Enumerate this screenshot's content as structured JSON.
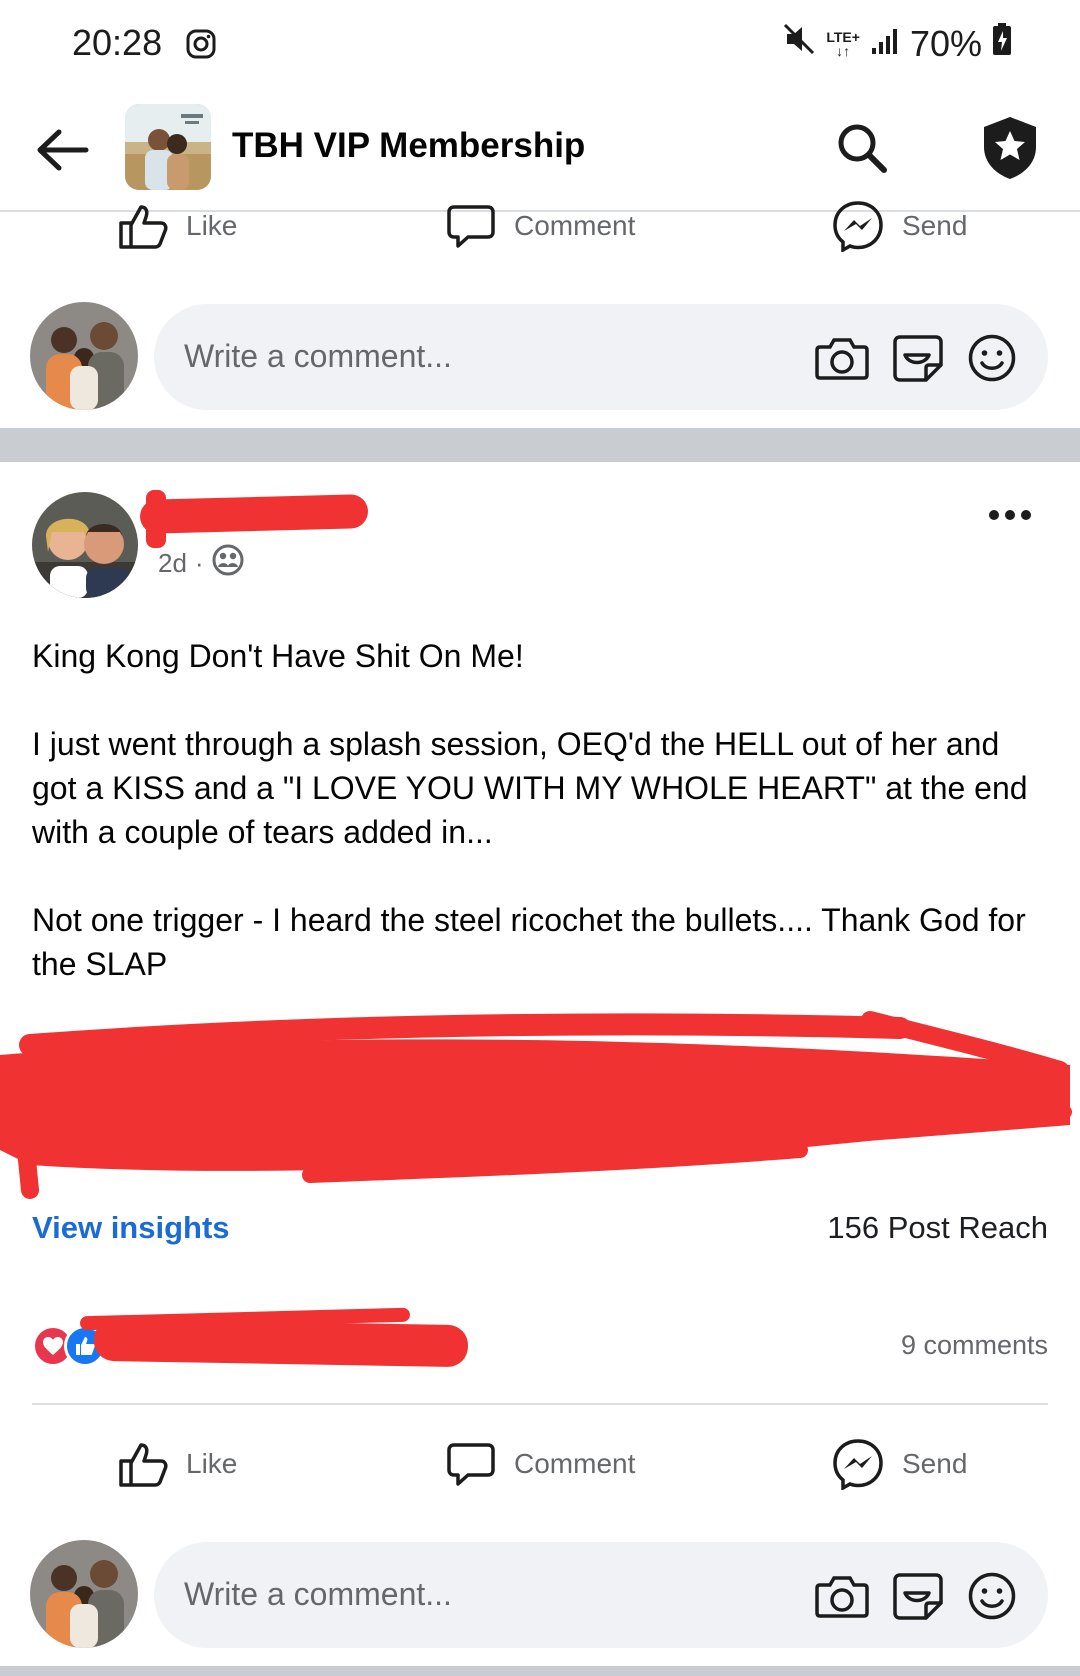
{
  "status_bar": {
    "time": "20:28",
    "network": "LTE+",
    "battery": "70%",
    "icons": [
      "instagram-icon",
      "mute-icon",
      "signal-icon",
      "battery-charging-icon"
    ]
  },
  "header": {
    "group_name": "TBH VIP Membership",
    "icons": [
      "back-arrow-icon",
      "search-icon",
      "shield-star-icon"
    ]
  },
  "prev_post_actions": {
    "like": "Like",
    "comment": "Comment",
    "send": "Send"
  },
  "prev_comment_box": {
    "placeholder": "Write a comment..."
  },
  "post": {
    "time_ago": "2d",
    "separator": "·",
    "privacy_icon": "group-members-icon",
    "paragraphs": [
      "King Kong Don't Have Shit On Me!",
      "I just went through a splash session, OEQ'd the HELL out of her and got a KISS and a \"I LOVE YOU WITH MY WHOLE HEART\" at the end with a couple of tears added in...",
      "Not one trigger - I heard the steel ricochet the bullets....  Thank God for the SLAP"
    ],
    "view_insights": "View insights",
    "post_reach": "156 Post Reach",
    "reaction_icons": [
      "love-reaction-icon",
      "like-reaction-icon"
    ],
    "comments_count": "9 comments"
  },
  "post_actions": {
    "like": "Like",
    "comment": "Comment",
    "send": "Send"
  },
  "comment_box": {
    "placeholder": "Write a comment..."
  },
  "colors": {
    "link_blue": "#1b6bd6",
    "muted_text": "#65676b",
    "input_bg": "#f0f2f5",
    "redaction_red": "#f03232",
    "love_red": "#e8364f",
    "like_blue": "#1877f2"
  }
}
